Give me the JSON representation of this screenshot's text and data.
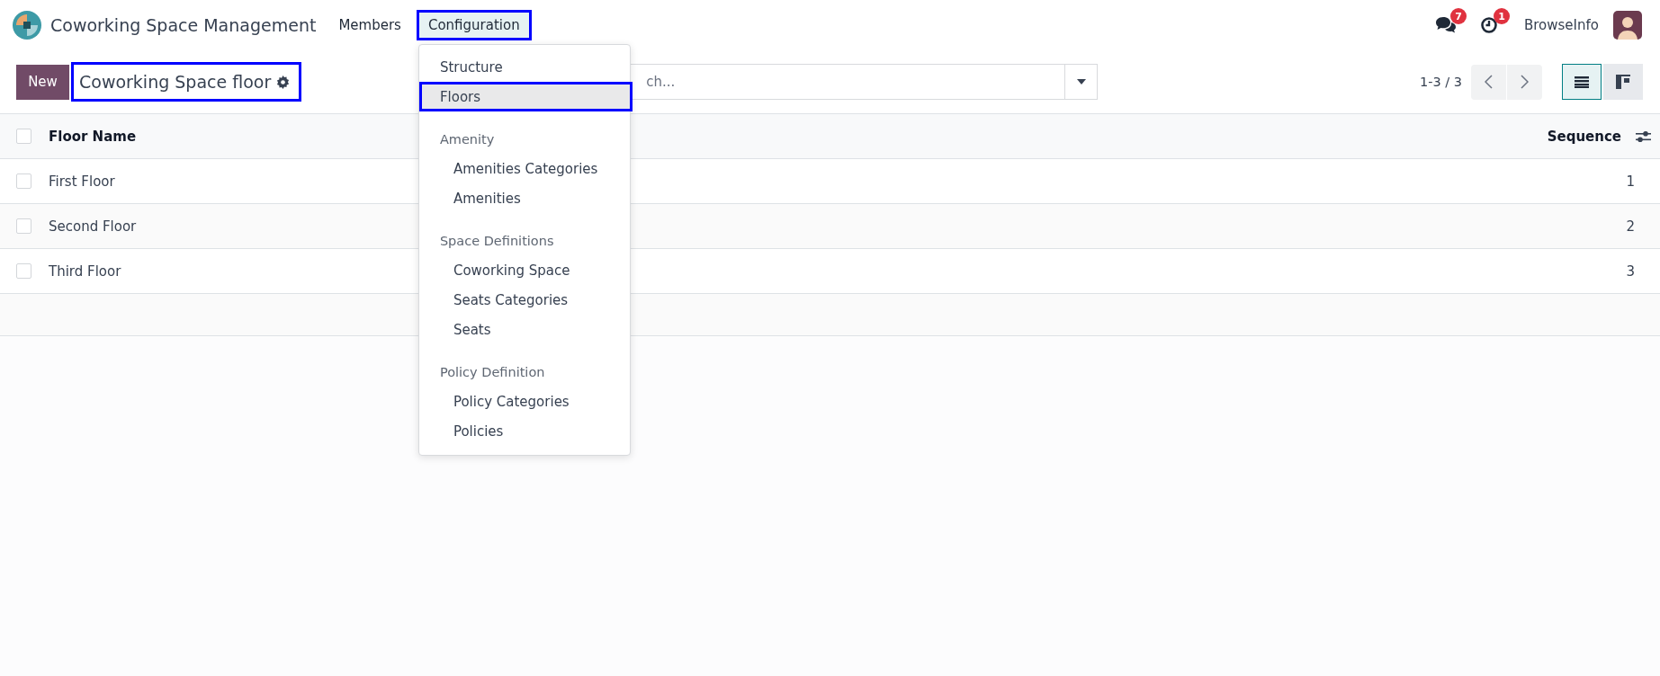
{
  "navbar": {
    "app_name": "Coworking Space Management",
    "menus": [
      {
        "label": "Members",
        "selected": false,
        "outlined": false
      },
      {
        "label": "Configuration",
        "selected": true,
        "outlined": true
      }
    ],
    "notifications": [
      {
        "kind": "messages",
        "count": "7"
      },
      {
        "kind": "activities",
        "count": "1"
      }
    ],
    "user": "BrowseInfo"
  },
  "dropdown": {
    "items": [
      {
        "kind": "item",
        "label": "Structure",
        "selected": false,
        "outlined": false
      },
      {
        "kind": "item",
        "label": "Floors",
        "selected": true,
        "outlined": true
      },
      {
        "kind": "header",
        "label": "Amenity"
      },
      {
        "kind": "subitem",
        "label": "Amenities Categories",
        "selected": false,
        "outlined": false
      },
      {
        "kind": "subitem",
        "label": "Amenities",
        "selected": false,
        "outlined": false
      },
      {
        "kind": "header",
        "label": "Space Definitions"
      },
      {
        "kind": "subitem",
        "label": "Coworking Space",
        "selected": false,
        "outlined": false
      },
      {
        "kind": "subitem",
        "label": "Seats Categories",
        "selected": false,
        "outlined": false
      },
      {
        "kind": "subitem",
        "label": "Seats",
        "selected": false,
        "outlined": false
      },
      {
        "kind": "header",
        "label": "Policy Definition"
      },
      {
        "kind": "subitem",
        "label": "Policy Categories",
        "selected": false,
        "outlined": false
      },
      {
        "kind": "subitem",
        "label": "Policies",
        "selected": false,
        "outlined": false
      }
    ]
  },
  "control_panel": {
    "new_button": "New",
    "title": "Coworking Space floor",
    "title_outlined": true,
    "search": {
      "placeholder": "ch..."
    },
    "pager": "1-3 / 3",
    "views": [
      {
        "kind": "list",
        "selected": true
      },
      {
        "kind": "kanban",
        "selected": false
      }
    ]
  },
  "table": {
    "columns": [
      "Floor Name",
      "Sequence"
    ],
    "header_checked": false,
    "rows": [
      {
        "name": "First Floor",
        "sequence": "1",
        "checked": false
      },
      {
        "name": "Second Floor",
        "sequence": "2",
        "checked": false
      },
      {
        "name": "Third Floor",
        "sequence": "3",
        "checked": false
      }
    ]
  }
}
